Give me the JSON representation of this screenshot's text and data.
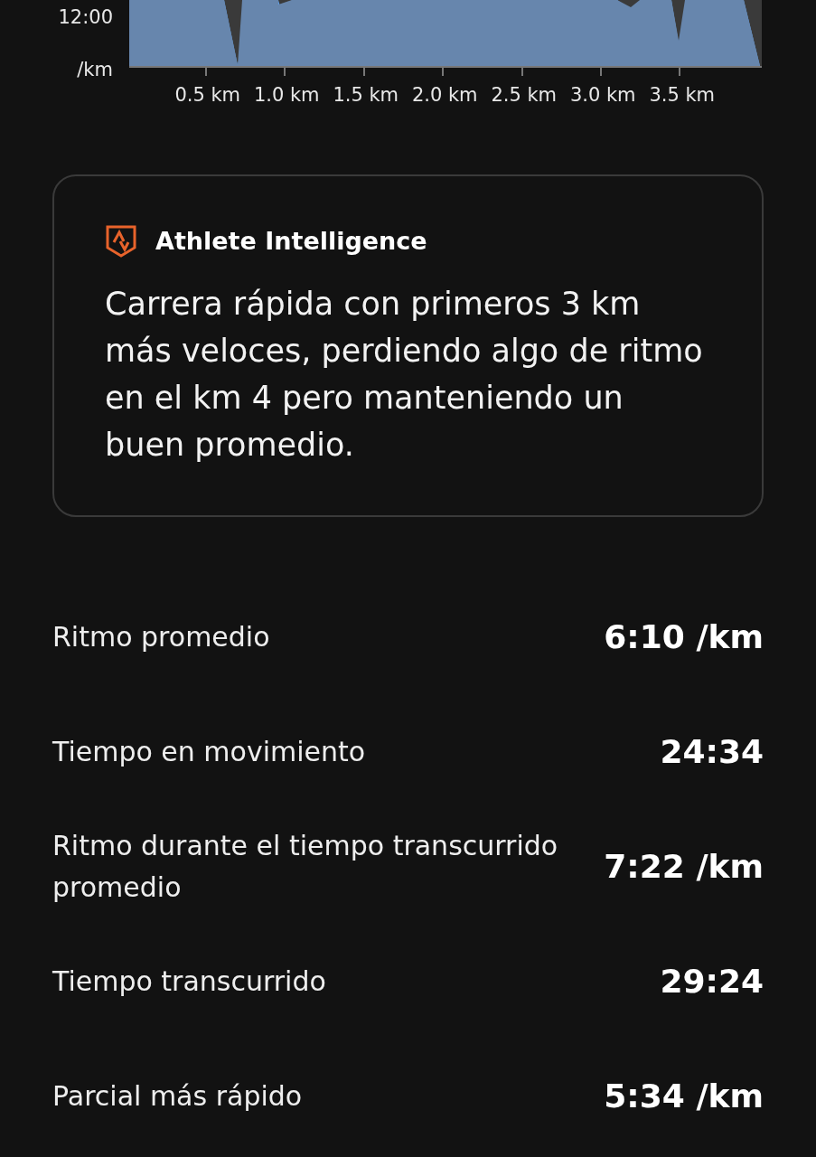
{
  "pace_chart": {
    "y_labels": [
      "12:00",
      "/km"
    ],
    "x_labels": [
      "0.5 km",
      "1.0 km",
      "1.5 km",
      "2.0 km",
      "2.5 km",
      "3.0 km",
      "3.5 km"
    ]
  },
  "insight_card": {
    "title": "Athlete Intelligence",
    "text": "Carrera rápida con primeros 3 km más veloces, perdiendo algo de ritmo en el km 4 pero manteniendo un buen promedio."
  },
  "stats": [
    {
      "label": "Ritmo promedio",
      "value": "6:10 /km"
    },
    {
      "label": "Tiempo en movimiento",
      "value": "24:34"
    },
    {
      "label": "Ritmo durante el tiempo transcurrido promedio",
      "value": "7:22 /km"
    },
    {
      "label": "Tiempo transcurrido",
      "value": "29:24"
    },
    {
      "label": "Parcial más rápido",
      "value": "5:34 /km"
    }
  ]
}
